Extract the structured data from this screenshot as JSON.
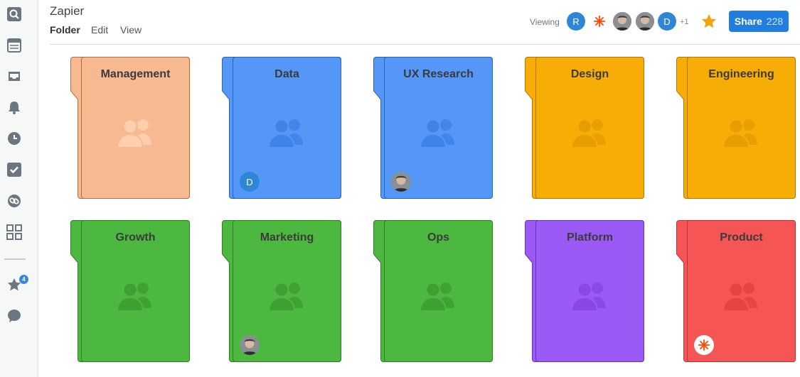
{
  "app": {
    "title": "Zapier"
  },
  "menu": {
    "items": [
      "Folder",
      "Edit",
      "View"
    ]
  },
  "sidebar": {
    "icons": [
      "search-icon",
      "browser-icon",
      "inbox-icon",
      "bell-icon",
      "clock-icon",
      "checkbox-icon",
      "link-icon",
      "grid-icon",
      "star-icon",
      "chat-icon"
    ],
    "star_badge": "4"
  },
  "viewers": {
    "label": "Viewing",
    "avatars": [
      {
        "type": "letter",
        "text": "R"
      },
      {
        "type": "logo",
        "text": ""
      },
      {
        "type": "photo",
        "text": ""
      },
      {
        "type": "photo",
        "text": ""
      },
      {
        "type": "letter",
        "text": "D"
      }
    ],
    "more": "+1"
  },
  "share": {
    "label": "Share",
    "count": "228"
  },
  "folders": [
    {
      "name": "Management",
      "color": "#f7b992",
      "border": "#b56a3a",
      "shade": "#ffcfae",
      "avatar": null
    },
    {
      "name": "Data",
      "color": "#5597f7",
      "border": "#2a63b8",
      "shade": "#3f82e8",
      "avatar": {
        "type": "letter",
        "text": "D"
      }
    },
    {
      "name": "UX Research",
      "color": "#5597f7",
      "border": "#2a63b8",
      "shade": "#3f82e8",
      "avatar": {
        "type": "photo",
        "text": ""
      }
    },
    {
      "name": "Design",
      "color": "#f8ad06",
      "border": "#b07a00",
      "shade": "#e59d00",
      "avatar": null
    },
    {
      "name": "Engineering",
      "color": "#f8ad06",
      "border": "#b07a00",
      "shade": "#e59d00",
      "avatar": null
    },
    {
      "name": "Growth",
      "color": "#4cb83f",
      "border": "#2d7f25",
      "shade": "#3ea032",
      "avatar": null
    },
    {
      "name": "Marketing",
      "color": "#4cb83f",
      "border": "#2d7f25",
      "shade": "#3ea032",
      "avatar": {
        "type": "photo",
        "text": ""
      }
    },
    {
      "name": "Ops",
      "color": "#4cb83f",
      "border": "#2d7f25",
      "shade": "#3ea032",
      "avatar": null
    },
    {
      "name": "Platform",
      "color": "#9b59f5",
      "border": "#6a33b8",
      "shade": "#8a47e6",
      "avatar": null
    },
    {
      "name": "Product",
      "color": "#f55555",
      "border": "#b83636",
      "shade": "#e44444",
      "avatar": {
        "type": "logo",
        "text": ""
      }
    }
  ]
}
